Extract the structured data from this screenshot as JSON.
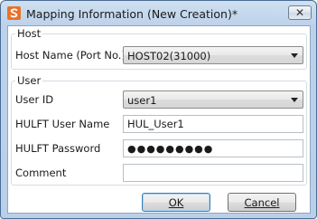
{
  "window": {
    "title": "Mapping Information (New Creation)*",
    "close_label": "✕"
  },
  "host_group": {
    "label": "Host",
    "host_name_label": "Host Name (Port No.)",
    "host_name_value": "HOST02(31000)"
  },
  "user_group": {
    "label": "User",
    "user_id_label": "User ID",
    "user_id_value": "user1",
    "hulft_user_name_label": "HULFT User Name",
    "hulft_user_name_value": "HUL_User1",
    "hulft_password_label": "HULFT Password",
    "hulft_password_value": "●●●●●●●●●",
    "comment_label": "Comment",
    "comment_value": ""
  },
  "buttons": {
    "ok_label": "OK",
    "cancel_label": "Cancel"
  },
  "colors": {
    "title_bar": "#bcd2ea",
    "accent": "#3c7fb1",
    "app_icon": "#e8722a"
  },
  "icons": {
    "app": "app-logo-icon",
    "close": "close-icon",
    "dropdown": "chevron-down-icon"
  }
}
